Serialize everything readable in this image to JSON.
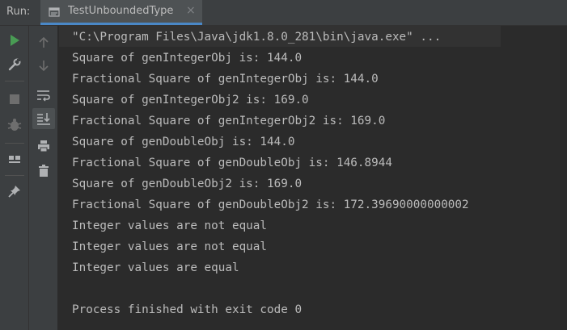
{
  "run_panel": {
    "label": "Run:",
    "tab_title": "TestUnboundedType",
    "tab_close": "×"
  },
  "toolbar_left": [
    {
      "name": "rerun-icon",
      "color": "#499c54"
    },
    {
      "name": "settings-wrench-icon",
      "color": "#afb1b3"
    },
    {
      "name": "stop-icon",
      "color": "#6e6e6e"
    },
    {
      "name": "debug-bug-icon",
      "color": "#6e6e6e"
    },
    {
      "name": "layout-icon",
      "color": "#afb1b3"
    },
    {
      "name": "pin-icon",
      "color": "#afb1b3"
    }
  ],
  "toolbar_right": [
    {
      "name": "up-arrow-icon",
      "color": "#6e6e6e"
    },
    {
      "name": "down-arrow-icon",
      "color": "#6e6e6e"
    },
    {
      "name": "soft-wrap-icon",
      "color": "#afb1b3"
    },
    {
      "name": "scroll-to-end-icon",
      "color": "#afb1b3"
    },
    {
      "name": "print-icon",
      "color": "#afb1b3"
    },
    {
      "name": "trash-icon",
      "color": "#afb1b3"
    }
  ],
  "console": {
    "command": "\"C:\\Program Files\\Java\\jdk1.8.0_281\\bin\\java.exe\" ...",
    "lines": [
      "Square of genIntegerObj is: 144.0",
      "Fractional Square of genIntegerObj is: 144.0",
      "Square of genIntegerObj2 is: 169.0",
      "Fractional Square of genIntegerObj2 is: 169.0",
      "Square of genDoubleObj is: 144.0",
      "Fractional Square of genDoubleObj is: 146.8944",
      "Square of genDoubleObj2 is: 169.0",
      "Fractional Square of genDoubleObj2 is: 172.39690000000002",
      "Integer values are not equal",
      "Integer values are not equal",
      "Integer values are equal",
      "",
      "Process finished with exit code 0"
    ]
  },
  "colors": {
    "background": "#2b2b2b",
    "panel": "#3c3f41",
    "text": "#bbbbbb",
    "accent": "#4a88c7",
    "run_green": "#499c54"
  }
}
